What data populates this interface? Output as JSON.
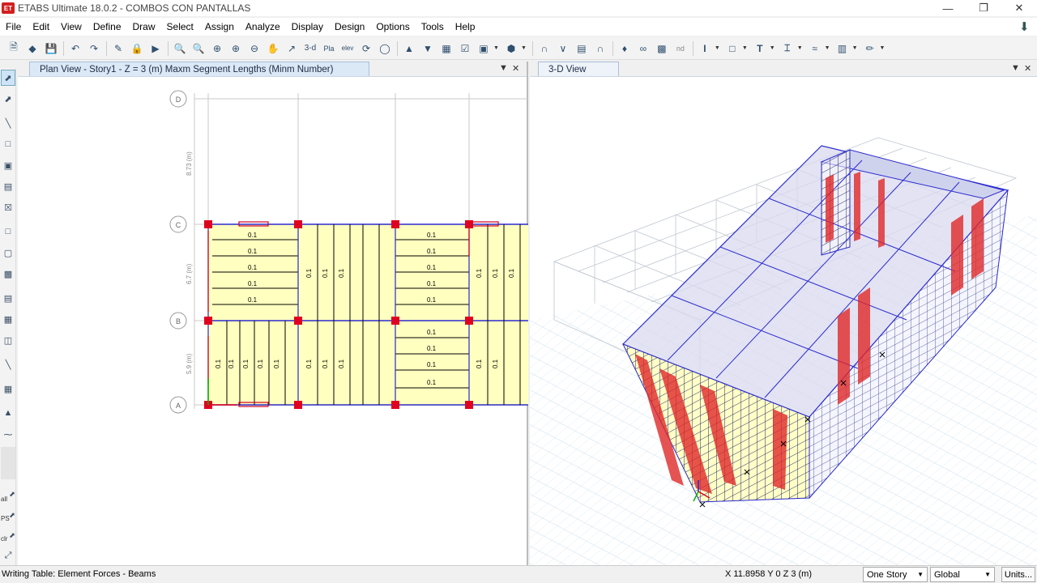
{
  "window": {
    "title": "ETABS Ultimate 18.0.2 - COMBOS CON PANTALLAS",
    "app_badge": "ET"
  },
  "menu": [
    "File",
    "Edit",
    "View",
    "Define",
    "Draw",
    "Select",
    "Assign",
    "Analyze",
    "Display",
    "Design",
    "Options",
    "Tools",
    "Help"
  ],
  "toolbar": {
    "btn_3d": "3-d",
    "btn_pla": "Pla",
    "btn_elev": "elev",
    "btn_nd": "nd"
  },
  "left_toolbar": {
    "label_all": "all",
    "label_ps": "PS",
    "label_clr": "clr"
  },
  "plan_view": {
    "tab_title": "Plan View - Story1 - Z = 3 (m)  Maxm Segment Lengths (Minm Number)",
    "grid_rows": [
      "D",
      "C",
      "B",
      "A"
    ],
    "dimensions": [
      "8.73 (m)",
      "6.7 (m)",
      "5.9 (m)"
    ],
    "segment_label": "0.1"
  },
  "view_3d": {
    "tab_title": "3-D View"
  },
  "status": {
    "message": "Writing Table: Element Forces - Beams",
    "coords": "X 11.8958  Y 0  Z 3 (m)",
    "story_select": "One Story",
    "coord_system": "Global",
    "units_label": "Units..."
  },
  "colors": {
    "slab": "#ffffc0",
    "beam": "#2a2ad0",
    "column": "#e00020",
    "tab_active": "#dbe8f6"
  }
}
